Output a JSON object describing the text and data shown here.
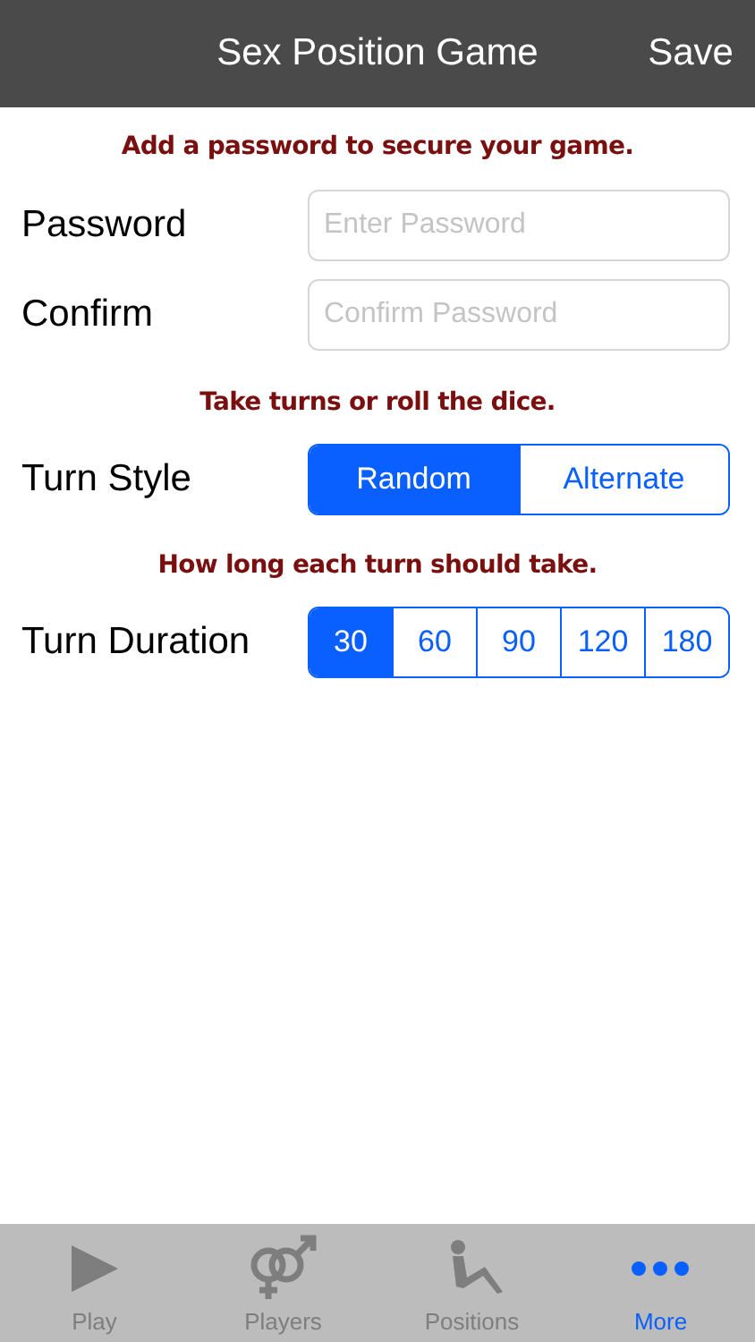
{
  "header": {
    "title": "Sex Position Game",
    "save": "Save"
  },
  "password_hint": "Add a password to secure your game.",
  "password": {
    "label": "Password",
    "placeholder": "Enter Password"
  },
  "confirm": {
    "label": "Confirm",
    "placeholder": "Confirm Password"
  },
  "turn_style_hint": "Take turns or roll the dice.",
  "turn_style": {
    "label": "Turn Style",
    "options": [
      {
        "label": "Random",
        "selected": true
      },
      {
        "label": "Alternate",
        "selected": false
      }
    ]
  },
  "duration_hint": "How long each turn should take.",
  "turn_duration": {
    "label": "Turn Duration",
    "options": [
      {
        "label": "30",
        "selected": true
      },
      {
        "label": "60",
        "selected": false
      },
      {
        "label": "90",
        "selected": false
      },
      {
        "label": "120",
        "selected": false
      },
      {
        "label": "180",
        "selected": false
      }
    ]
  },
  "tab_bar": [
    {
      "label": "Play",
      "kind": "play",
      "selected": false
    },
    {
      "label": "Players",
      "kind": "players",
      "selected": false
    },
    {
      "label": "Positions",
      "kind": "positions",
      "selected": false
    },
    {
      "label": "More",
      "kind": "more",
      "selected": true
    }
  ]
}
